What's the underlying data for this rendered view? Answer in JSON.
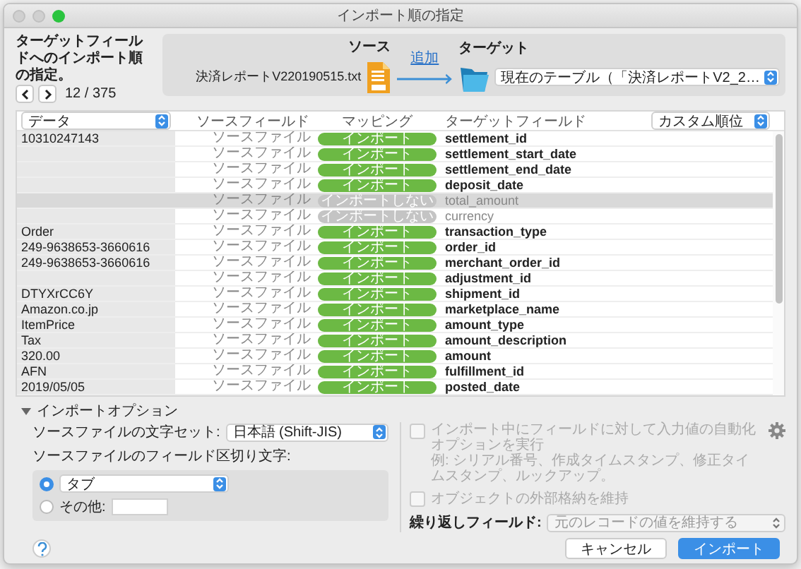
{
  "window": {
    "title": "インポート順の指定"
  },
  "instruction": "ターゲットフィールドへのインポート順の指定。",
  "record_counter": "12 / 375",
  "source": {
    "label": "ソース",
    "file": "決済レポートV220190515.txt"
  },
  "add_link": "追加",
  "target": {
    "label": "ターゲット",
    "table": "現在のテーブル（「決済レポートV2_2…"
  },
  "table": {
    "data_select": "データ",
    "columns": [
      "ソースフィールド",
      "マッピング",
      "ターゲットフィールド"
    ],
    "order_select": "カスタム順位",
    "rows": [
      {
        "data": "10310247143",
        "source": "ソースファイル",
        "mapping": "インポート",
        "import": true,
        "target": "settlement_id",
        "selected": false
      },
      {
        "source": "ソースファイル",
        "mapping": "インポート",
        "import": true,
        "target": "settlement_start_date",
        "selected": false
      },
      {
        "source": "ソースファイル",
        "mapping": "インポート",
        "import": true,
        "target": "settlement_end_date",
        "selected": false
      },
      {
        "source": "ソースファイル",
        "mapping": "インポート",
        "import": true,
        "target": "deposit_date",
        "selected": false
      },
      {
        "source": "ソースファイル",
        "mapping": "インポートしない",
        "import": false,
        "target": "total_amount",
        "selected": true
      },
      {
        "source": "ソースファイル",
        "mapping": "インポートしない",
        "import": false,
        "target": "currency",
        "selected": false
      },
      {
        "data": "Order",
        "source": "ソースファイル",
        "mapping": "インポート",
        "import": true,
        "target": "transaction_type",
        "selected": false
      },
      {
        "data": "249-9638653-3660616",
        "source": "ソースファイル",
        "mapping": "インポート",
        "import": true,
        "target": "order_id",
        "selected": false
      },
      {
        "data": "249-9638653-3660616",
        "source": "ソースファイル",
        "mapping": "インポート",
        "import": true,
        "target": "merchant_order_id",
        "selected": false
      },
      {
        "source": "ソースファイル",
        "mapping": "インポート",
        "import": true,
        "target": "adjustment_id",
        "selected": false
      },
      {
        "data": "DTYXrCC6Y",
        "source": "ソースファイル",
        "mapping": "インポート",
        "import": true,
        "target": "shipment_id",
        "selected": false
      },
      {
        "data": "Amazon.co.jp",
        "source": "ソースファイル",
        "mapping": "インポート",
        "import": true,
        "target": "marketplace_name",
        "selected": false
      },
      {
        "data": "ItemPrice",
        "source": "ソースファイル",
        "mapping": "インポート",
        "import": true,
        "target": "amount_type",
        "selected": false
      },
      {
        "data": "Tax",
        "source": "ソースファイル",
        "mapping": "インポート",
        "import": true,
        "target": "amount_description",
        "selected": false
      },
      {
        "data": "320.00",
        "source": "ソースファイル",
        "mapping": "インポート",
        "import": true,
        "target": "amount",
        "selected": false
      },
      {
        "data": "AFN",
        "source": "ソースファイル",
        "mapping": "インポート",
        "import": true,
        "target": "fulfillment_id",
        "selected": false
      },
      {
        "data": "2019/05/05",
        "source": "ソースファイル",
        "mapping": "インポート",
        "import": true,
        "target": "posted_date",
        "selected": false
      }
    ]
  },
  "options": {
    "title": "インポートオプション",
    "expanded": true,
    "charset_label": "ソースファイルの文字セット:",
    "charset": "日本語 (Shift-JIS)",
    "delimiter_label": "ソースファイルのフィールド区切り文字:",
    "delimiters": [
      {
        "kind": "select",
        "value": "タブ",
        "selected": true
      },
      {
        "kind": "other",
        "label": "その他:",
        "selected": false
      }
    ],
    "auto_enter": {
      "label": "インポート中にフィールドに対して入力値の自動化オプションを実行",
      "hint": "例: シリアル番号、作成タイムスタンプ、修正タイムスタンプ、ルックアップ。",
      "checked": false,
      "disabled": true
    },
    "external_storage": {
      "label": "オブジェクトの外部格納を維持",
      "checked": false,
      "disabled": true
    },
    "repeating": {
      "label": "繰り返しフィールド:",
      "value": "元のレコードの値を維持する",
      "disabled": true
    }
  },
  "buttons": [
    {
      "label": "キャンセル",
      "default": false
    },
    {
      "label": "インポート",
      "default": true
    }
  ]
}
